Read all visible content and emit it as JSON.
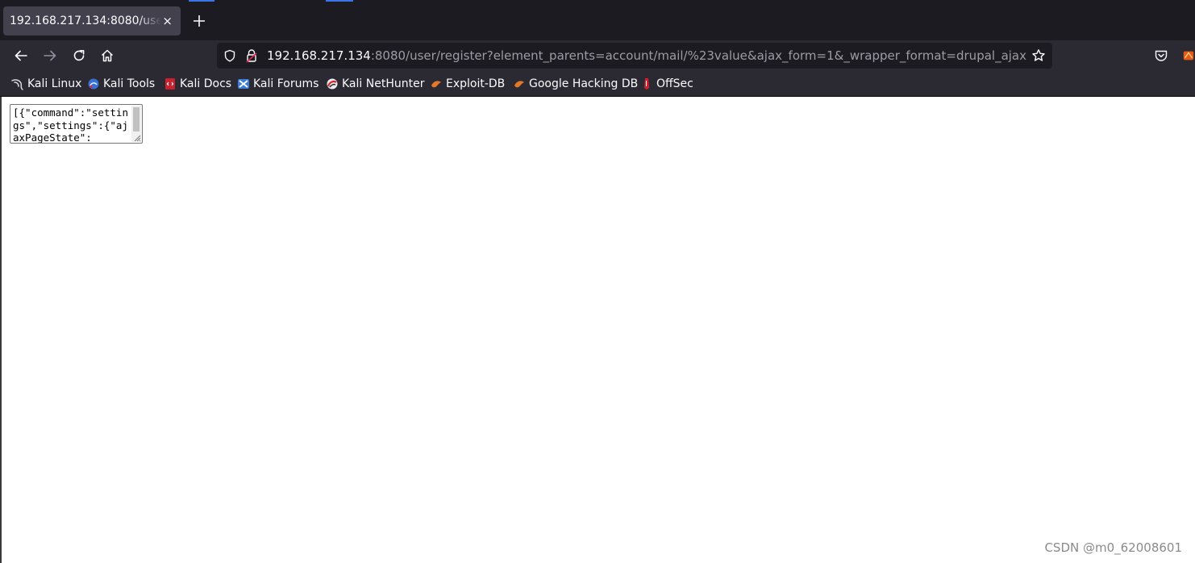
{
  "tab": {
    "title": "192.168.217.134:8080/user/register?element_parents=account/mail/%23value&ajax_form=1&_wrapper_format=drupal_ajax",
    "close_label": "×"
  },
  "new_tab_label": "+",
  "url": {
    "host": "192.168.217.134",
    "rest": ":8080/user/register?element_parents=account/mail/%23value&ajax_form=1&_wrapper_format=drupal_ajax"
  },
  "bookmarks": [
    {
      "label": "Kali Linux",
      "icon": "kali-dragon-icon"
    },
    {
      "label": "Kali Tools",
      "icon": "kali-tools-icon"
    },
    {
      "label": "Kali Docs",
      "icon": "kali-docs-icon"
    },
    {
      "label": "Kali Forums",
      "icon": "kali-forums-icon"
    },
    {
      "label": "Kali NetHunter",
      "icon": "nethunter-icon"
    },
    {
      "label": "Exploit-DB",
      "icon": "exploit-db-icon"
    },
    {
      "label": "Google Hacking DB",
      "icon": "ghdb-icon"
    },
    {
      "label": "OffSec",
      "icon": "offsec-icon"
    }
  ],
  "response": {
    "text": "[{\"command\":\"settings\",\"settings\":{\"ajaxPageState\":"
  },
  "watermark": "CSDN @m0_62008601",
  "colors": {
    "tab_strip": "#1c1b22",
    "toolbar": "#2b2a33",
    "active_tab": "#42414d",
    "accent": "#3b74e8"
  }
}
